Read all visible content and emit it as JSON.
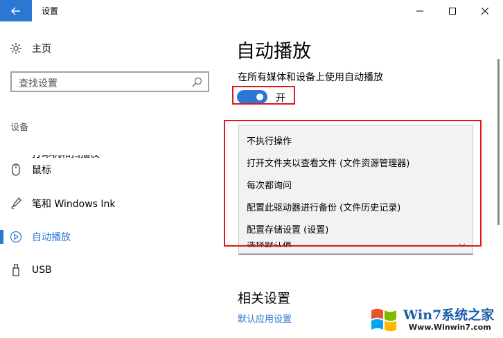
{
  "window": {
    "title": "设置"
  },
  "nav": {
    "home": "主页",
    "search_placeholder": "查找设置",
    "group": "设备",
    "clipped_item": "打印机和扫描仪",
    "items": [
      {
        "label": "鼠标",
        "icon": "mouse-icon"
      },
      {
        "label": "笔和 Windows Ink",
        "icon": "pen-icon"
      },
      {
        "label": "自动播放",
        "icon": "autoplay-icon",
        "active": true
      },
      {
        "label": "USB",
        "icon": "usb-icon"
      }
    ]
  },
  "main": {
    "title": "自动播放",
    "toggle_caption": "在所有媒体和设备上使用自动播放",
    "toggle_state": "开",
    "dropdown_options": [
      "不执行操作",
      "打开文件夹以查看文件 (文件资源管理器)",
      "每次都询问",
      "配置此驱动器进行备份 (文件历史记录)",
      "配置存储设置 (设置)"
    ],
    "dropdown_clipped": "选择默认值",
    "related_title": "相关设置",
    "related_link": "默认应用设置"
  },
  "watermark": {
    "brand": "Win7系统之家",
    "url": "Www.Winwin7.com"
  },
  "colors": {
    "accent": "#2b78d4",
    "highlight": "#e0161d"
  }
}
